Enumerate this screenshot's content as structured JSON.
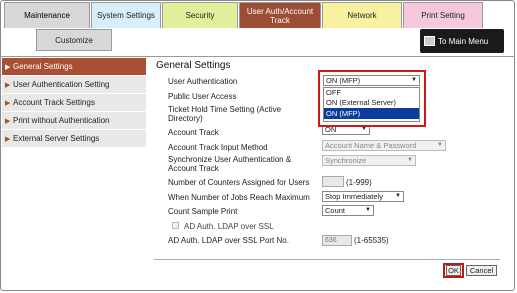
{
  "tabs": [
    "Maintenance",
    "System Settings",
    "Security",
    "User Auth/Account Track",
    "Network",
    "Print Setting"
  ],
  "subtab": "Customize",
  "to_main_menu": "To Main Menu",
  "sidebar": {
    "items": [
      {
        "label": "General Settings"
      },
      {
        "label": "User Authentication Setting"
      },
      {
        "label": "Account Track Settings"
      },
      {
        "label": "Print without Authentication"
      },
      {
        "label": "External Server Settings"
      }
    ]
  },
  "main": {
    "title": "General Settings",
    "user_auth_label": "User Authentication",
    "user_auth_value": "ON (MFP)",
    "public_user_label": "Public User Access",
    "ticket_hold_label": "Ticket Hold Time Setting (Active Directory)",
    "account_track_label": "Account Track",
    "account_track_value": "ON",
    "input_method_label": "Account Track Input Method",
    "input_method_value": "Account Name & Password",
    "sync_label": "Synchronize User Authentication & Account Track",
    "sync_value": "Synchronize",
    "counters_label": "Number of Counters Assigned for Users",
    "counters_range": "(1-999)",
    "jobs_max_label": "When Number of Jobs Reach Maximum",
    "jobs_max_value": "Stop Immediately",
    "count_sample_label": "Count Sample Print",
    "count_sample_value": "Count",
    "ad_ssl_label": "AD Auth. LDAP over SSL",
    "ad_port_label": "AD Auth. LDAP over SSL Port No.",
    "ad_port_value": "636",
    "ad_port_range": "(1-65535)"
  },
  "dropdown_options": [
    "OFF",
    "ON (External Server)",
    "ON (MFP)"
  ],
  "dropdown_selected_index": 2,
  "buttons": {
    "ok": "OK",
    "cancel": "Cancel"
  },
  "colors": {
    "accent": "#a84f34",
    "highlight": "#d01818",
    "selection": "#0a3d9c"
  }
}
